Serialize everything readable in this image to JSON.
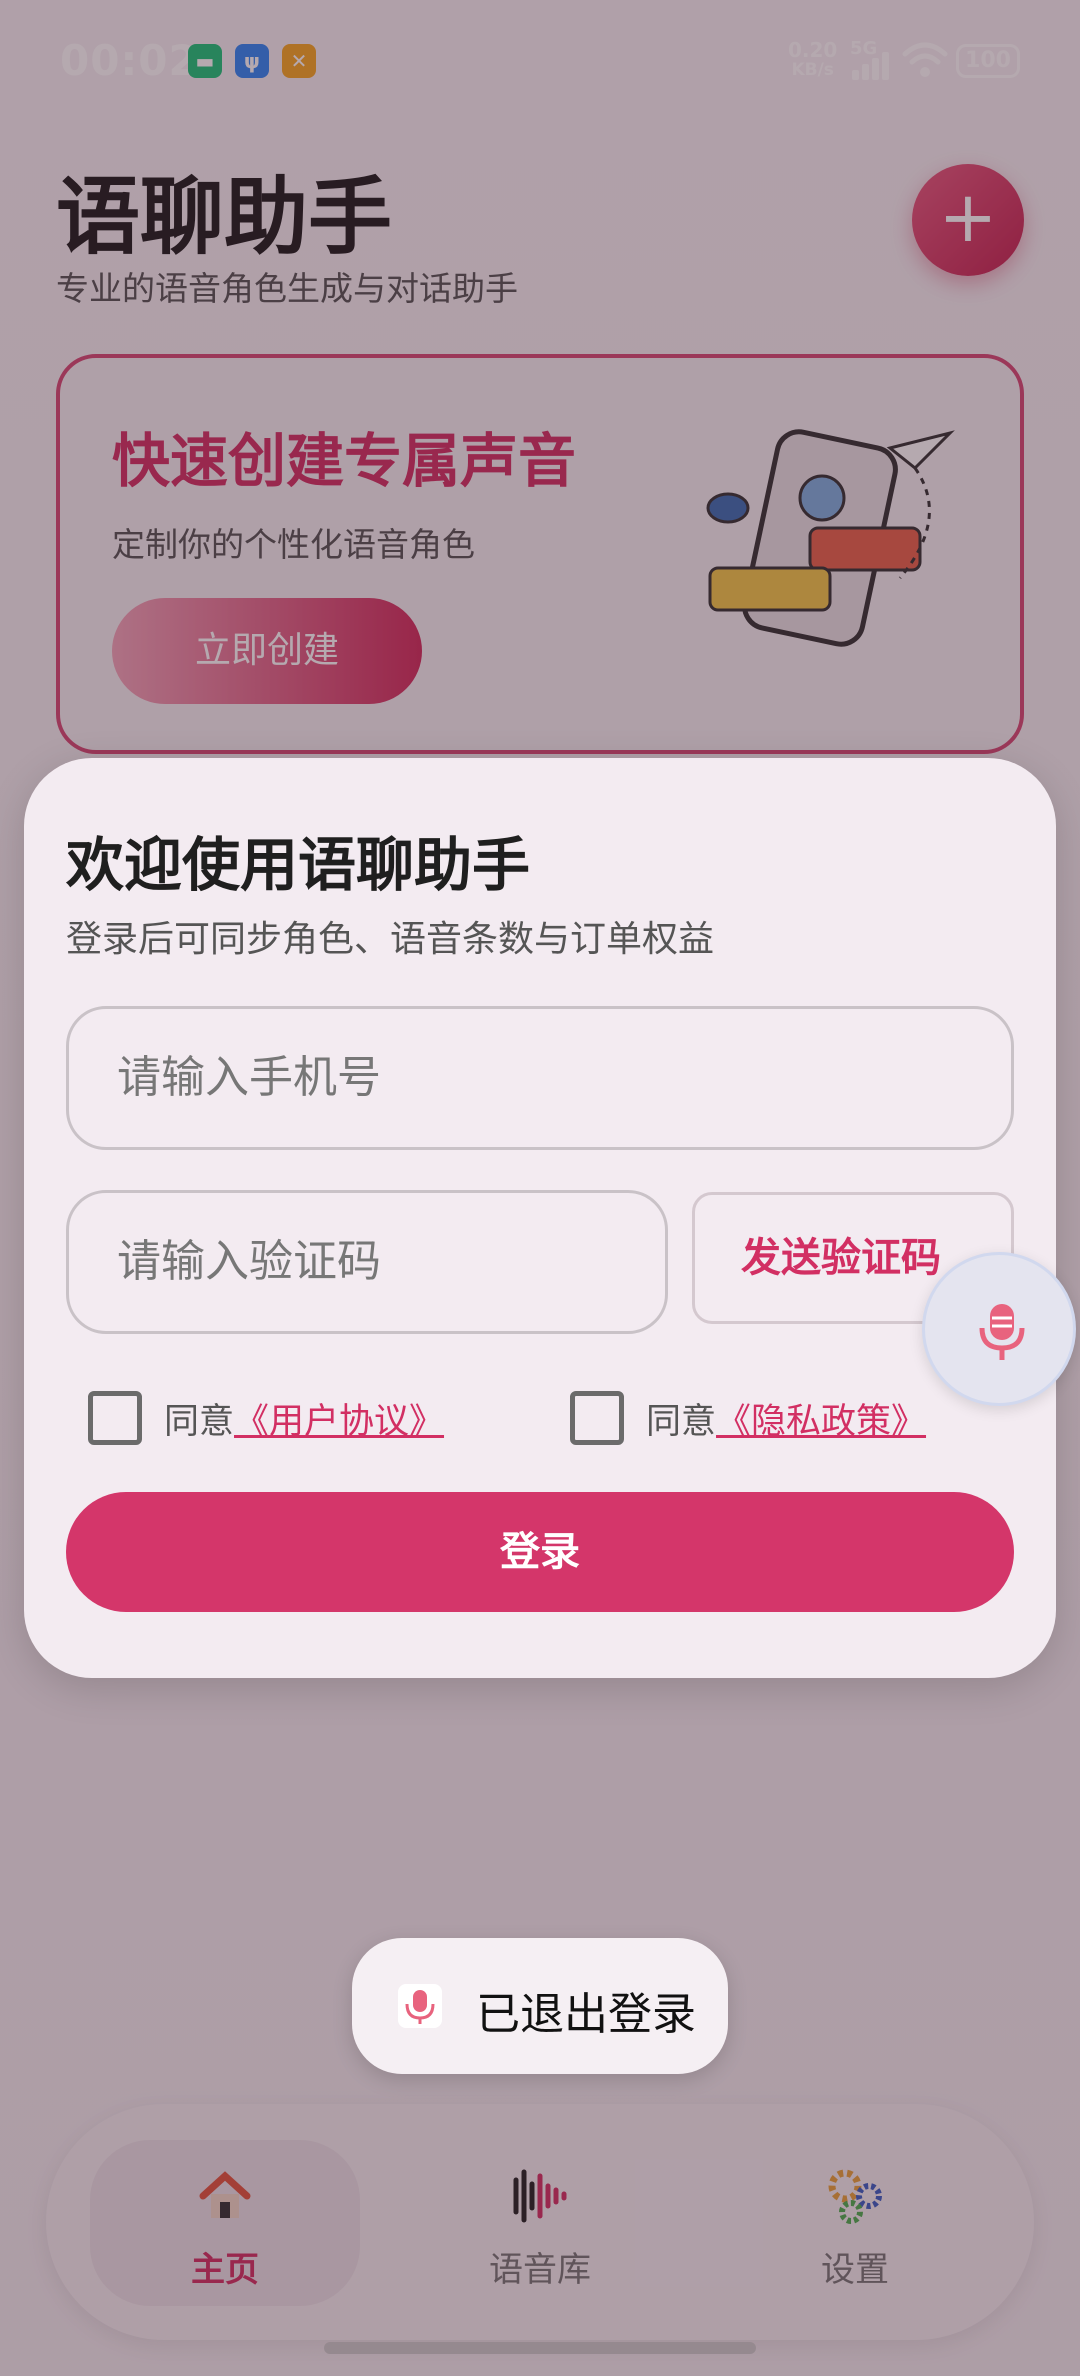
{
  "status_bar": {
    "time": "00:02",
    "net_speed_value": "0.20",
    "net_speed_unit": "KB/s",
    "network": "5G",
    "battery": "100"
  },
  "header": {
    "title": "语聊助手",
    "subtitle": "专业的语音角色生成与对话助手"
  },
  "banner": {
    "title": "快速创建专属声音",
    "subtitle": "定制你的个性化语音角色",
    "button": "立即创建"
  },
  "login_sheet": {
    "title": "欢迎使用语聊助手",
    "subtitle": "登录后可同步角色、语音条数与订单权益",
    "phone_placeholder": "请输入手机号",
    "code_placeholder": "请输入验证码",
    "send_code": "发送验证码",
    "agree_prefix": "同意",
    "user_agreement": "《用户协议》",
    "privacy_policy": "《隐私政策》",
    "login": "登录"
  },
  "toast": {
    "text": "已退出登录"
  },
  "nav": {
    "items": [
      {
        "label": "主页",
        "icon": "home-icon",
        "active": true
      },
      {
        "label": "语音库",
        "icon": "sound-wave-icon",
        "active": false
      },
      {
        "label": "设置",
        "icon": "gears-icon",
        "active": false
      }
    ]
  },
  "colors": {
    "accent": "#d4366a",
    "text_primary": "#1f1f1f",
    "text_secondary": "#555555"
  }
}
